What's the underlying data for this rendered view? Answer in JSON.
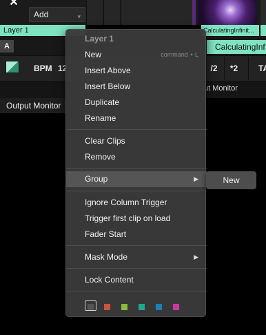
{
  "toolbar": {
    "close_glyph": "✕",
    "add_label": "Add",
    "add_caret": "▾"
  },
  "layer": {
    "name": "Layer 1",
    "tab_label": "A",
    "color": "#7fe3c2"
  },
  "clip": {
    "thumb_caption": "CalculatingInfinit...",
    "name": "CalculatingInf"
  },
  "transport": {
    "bpm_label": "BPM",
    "bpm_value": "12",
    "divide": "/2",
    "multiply": "*2",
    "tap": "TA"
  },
  "panels": {
    "output_monitor_right": "ut Monitor",
    "output_monitor_left": "Output Monitor"
  },
  "context_menu": {
    "title": "Layer 1",
    "items": [
      {
        "label": "New",
        "shortcut": "command + L"
      },
      {
        "label": "Insert Above"
      },
      {
        "label": "Insert Below"
      },
      {
        "label": "Duplicate"
      },
      {
        "label": "Rename"
      },
      {
        "label": "Clear Clips"
      },
      {
        "label": "Remove"
      },
      {
        "label": "Group",
        "arrow": "▶"
      },
      {
        "label": "Ignore Column Trigger"
      },
      {
        "label": "Trigger first clip on load"
      },
      {
        "label": "Fader Start"
      },
      {
        "label": "Mask Mode",
        "arrow": "▶"
      },
      {
        "label": "Lock Content"
      }
    ],
    "swatches": [
      "#555555",
      "#c8553d",
      "#8ab83a",
      "#1fa890",
      "#1f7fb8",
      "#c83aa0"
    ]
  },
  "submenu": {
    "new_label": "New"
  }
}
